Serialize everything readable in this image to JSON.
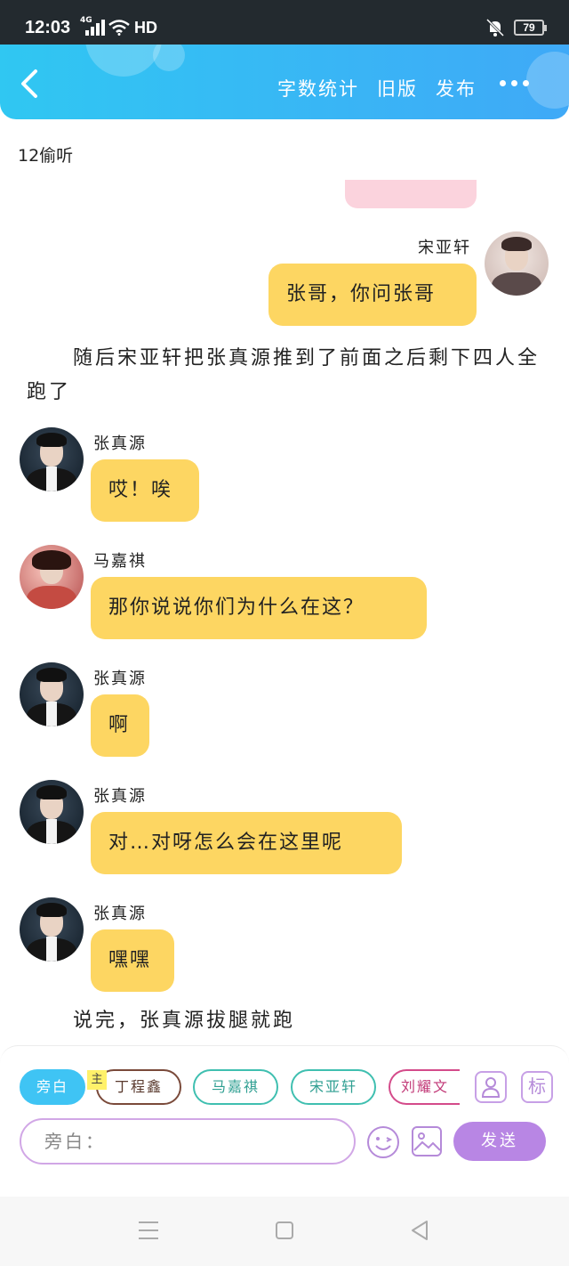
{
  "status": {
    "time": "12:03",
    "network": "4G",
    "signal_label": "HD",
    "battery": "79"
  },
  "toolbar": {
    "word_count": "字数统计",
    "old_version": "旧版",
    "publish": "发布"
  },
  "chapter": {
    "title": "12偷听"
  },
  "messages": [
    {
      "name": "宋亚轩",
      "text": "张哥，你问张哥"
    },
    {
      "name": "张真源",
      "text": "哎！唉"
    },
    {
      "name": "马嘉祺",
      "text": "那你说说你们为什么在这？"
    },
    {
      "name": "张真源",
      "text": "啊"
    },
    {
      "name": "张真源",
      "text": "对…对呀怎么会在这里呢"
    },
    {
      "name": "张真源",
      "text": "嘿嘿"
    }
  ],
  "narrations": [
    "随后宋亚轩把张真源推到了前面之后剩下四人全跑了",
    "说完，张真源拔腿就跑"
  ],
  "composer": {
    "main_tag": "主",
    "chips": [
      "旁白",
      "丁程鑫",
      "马嘉祺",
      "宋亚轩",
      "刘耀文"
    ],
    "tag_btn": "标",
    "input_value": "旁白：",
    "send": "发送"
  },
  "colors": {
    "accent": "#3fb8f4",
    "bubble": "#fdd662",
    "send": "#b886e4",
    "chip_teal": "#3fbfb0"
  }
}
